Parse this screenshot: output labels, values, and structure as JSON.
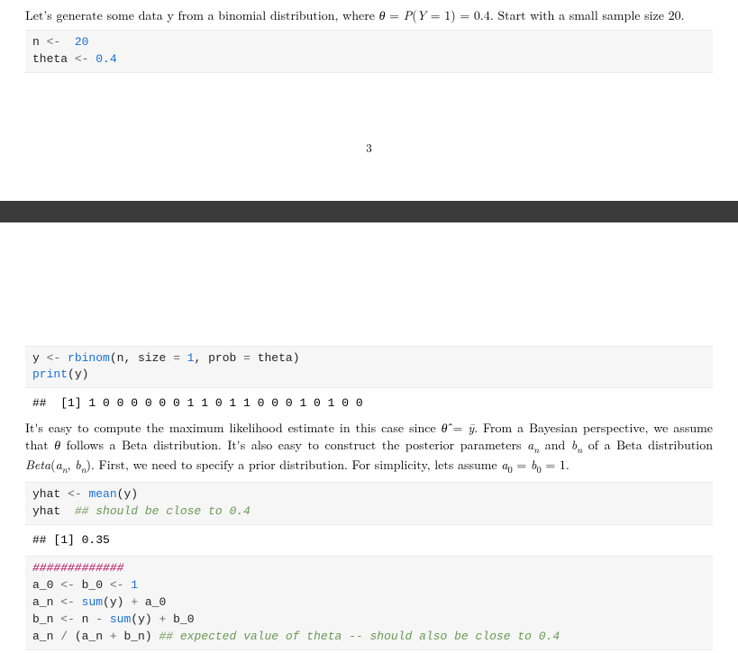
{
  "page1": {
    "intro": "Let's generate some data y from a binomial distribution, where θ = P(Y = 1) = 0.4. Start with a small sample size 20.",
    "code": {
      "l1": "n ",
      "op1": "<-",
      "sp1": "  ",
      "v1": "20",
      "l2": "theta ",
      "op2": "<-",
      "sp2": " ",
      "v2": "0.4"
    },
    "pagenum": "3"
  },
  "page2": {
    "code1": {
      "a": "y ",
      "op": "<-",
      "sp": " ",
      "fn": "rbinom",
      "args": "(n, size ",
      "eq": "=",
      "one": " 1",
      "c": ", prob ",
      "eq2": "=",
      "th": " theta)",
      "p": "print",
      "py": "(y)"
    },
    "out1": "##  [1] 1 0 0 0 0 0 0 1 1 0 1 1 0 0 0 1 0 1 0 0",
    "prose2_a": "It's easy to compute the maximum likelihood estimate in this case since ",
    "prose2_b": ". From a Bayesian perspective, we assume that ",
    "prose2_c": " follows a Beta distribution. It's also easy to construct the posterior parameters ",
    "prose2_d": " and ",
    "prose2_e": " of a Beta distribution ",
    "prose2_f": ". First, we need to specify a prior distribution. For simplicity, lets assume ",
    "prose2_g": ".",
    "math": {
      "thetahat_eq_ybar": "θ̂ = ȳ",
      "theta": "θ",
      "an": "aₙ",
      "bn": "bₙ",
      "beta": "Beta(aₙ, bₙ)",
      "a0b0": "a₀ = b₀ = 1"
    },
    "code2": {
      "l1a": "yhat ",
      "l1op": "<-",
      "l1sp": " ",
      "l1fn": "mean",
      "l1arg": "(y)",
      "l2a": "yhat  ",
      "l2cmt": "## should be close to 0.4"
    },
    "out2": "## [1] 0.35",
    "code3": {
      "hashes": "#############",
      "r1a": "a_0 ",
      "op": "<-",
      "r1b": " b_0 ",
      "one": "1",
      "r2a": "a_n ",
      "r2fn": "sum",
      "r2arg": "(y) ",
      "plus": "+",
      "r2c": " a_0",
      "r3a": "b_n ",
      "r3b": " n ",
      "minus": "-",
      "r3sp": " ",
      "r3fn": "sum",
      "r3arg": "(y) ",
      "r3c": " b_0",
      "r4a": "a_n ",
      "slash": "/",
      "r4b": " (a_n ",
      "r4c": " b_n) ",
      "cmt": "## expected value of theta -- should also be close to 0.4"
    }
  }
}
